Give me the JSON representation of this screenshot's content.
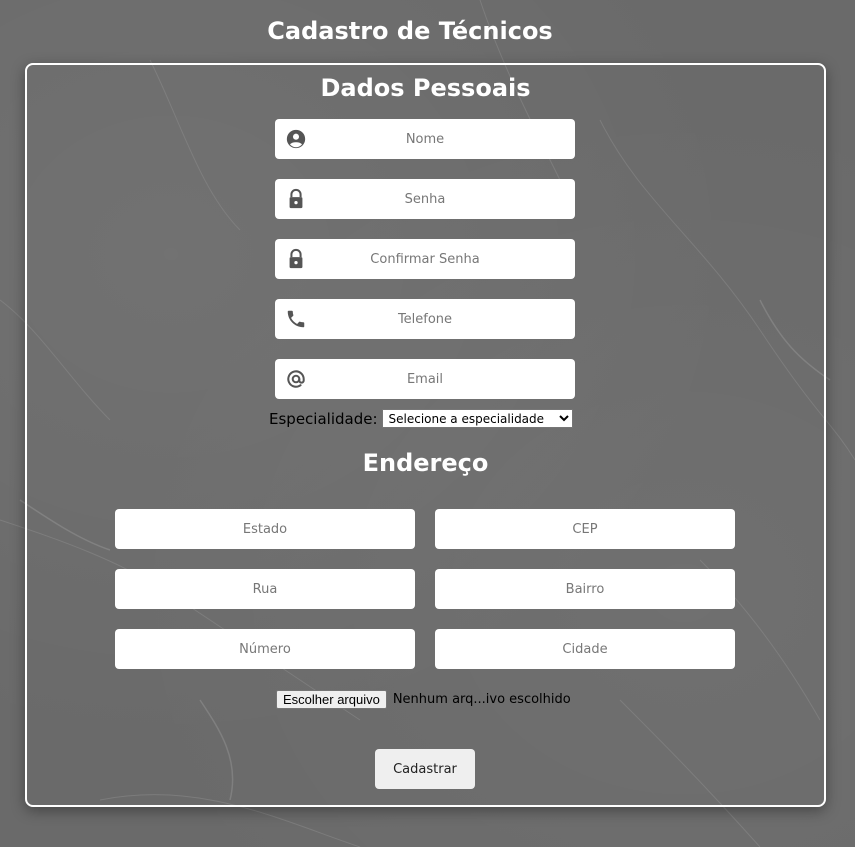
{
  "page": {
    "title": "Cadastro de Técnicos"
  },
  "dados_pessoais": {
    "title": "Dados Pessoais",
    "fields": {
      "nome": {
        "placeholder": "Nome",
        "icon": "user-circle-icon"
      },
      "senha": {
        "placeholder": "Senha",
        "icon": "lock-icon"
      },
      "confirmar_senha": {
        "placeholder": "Confirmar Senha",
        "icon": "lock-icon"
      },
      "telefone": {
        "placeholder": "Telefone",
        "icon": "phone-icon"
      },
      "email": {
        "placeholder": "Email",
        "icon": "at-sign-icon"
      }
    },
    "especialidade": {
      "label": "Especialidade:",
      "selected": "Selecione a especialidade"
    }
  },
  "endereco": {
    "title": "Endereço",
    "fields": {
      "estado": {
        "placeholder": "Estado"
      },
      "cep": {
        "placeholder": "CEP"
      },
      "rua": {
        "placeholder": "Rua"
      },
      "bairro": {
        "placeholder": "Bairro"
      },
      "numero": {
        "placeholder": "Número"
      },
      "cidade": {
        "placeholder": "Cidade"
      }
    }
  },
  "file_upload": {
    "button_label": "Escolher arquivo",
    "status": "Nenhum arq...ivo escolhido"
  },
  "submit": {
    "label": "Cadastrar"
  },
  "colors": {
    "background": "#6a6a6a",
    "card_border": "#ffffff",
    "title_text": "#ffffff",
    "input_bg": "#ffffff",
    "icon": "#555555",
    "button_bg": "#efefef"
  }
}
